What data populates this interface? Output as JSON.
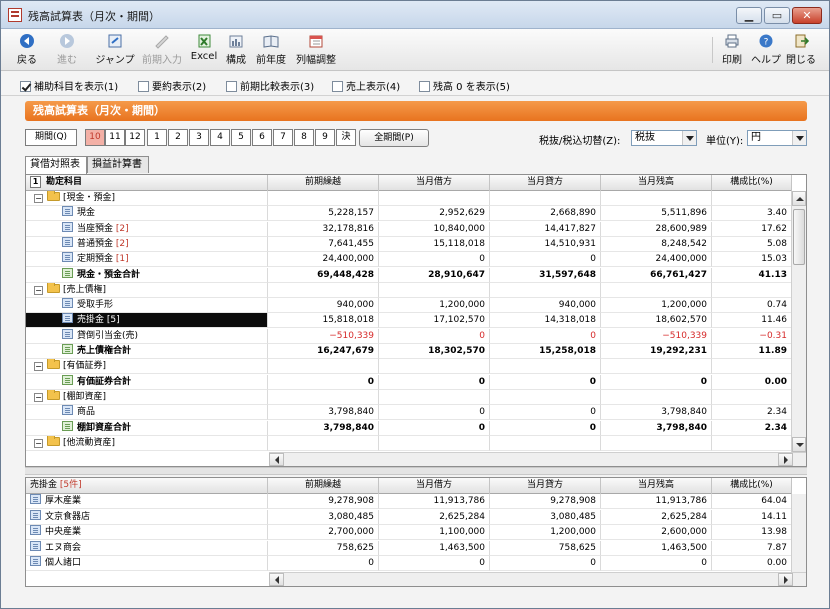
{
  "window": {
    "title": "残高試算表（月次・期間）",
    "controls": {
      "minimize": "▁",
      "maximize": "▭",
      "close": "✕"
    }
  },
  "toolbar": {
    "back": "戻る",
    "forward": "進む",
    "jump": "ジャンプ",
    "prev_input": "前期入力",
    "excel": "Excel",
    "composition": "構成",
    "prev_year": "前年度",
    "column_width": "列幅調整",
    "print": "印刷",
    "help": "ヘルプ",
    "close": "閉じる"
  },
  "options": [
    {
      "label": "補助科目を表示(1)",
      "checked": true
    },
    {
      "label": "要約表示(2)",
      "checked": false
    },
    {
      "label": "前期比較表示(3)",
      "checked": false
    },
    {
      "label": "売上表示(4)",
      "checked": false
    },
    {
      "label": "残高 0 を表示(5)",
      "checked": false
    }
  ],
  "report_title": "残高試算表（月次・期間）",
  "period": {
    "label": "期間(Q)",
    "months": [
      "10",
      "11",
      "12",
      "1",
      "2",
      "3",
      "4",
      "5",
      "6",
      "7",
      "8",
      "9",
      "決"
    ],
    "active_month": "10",
    "all_period": "全期間(P)"
  },
  "tax": {
    "label": "税抜/税込切替(Z):",
    "value": "税抜"
  },
  "unit": {
    "label": "単位(Y):",
    "value": "円"
  },
  "tabs": [
    "貸借対照表",
    "損益計算書"
  ],
  "main_table": {
    "columns": [
      "勘定科目",
      "前期繰越",
      "当月借方",
      "当月貸方",
      "当月残高",
      "構成比(%)"
    ],
    "header_number": "1",
    "rows": [
      {
        "type": "group",
        "name": "[現金・預金]"
      },
      {
        "type": "item",
        "name": "現金",
        "sub": "",
        "values": [
          "5,228,157",
          "2,952,629",
          "2,668,890",
          "5,511,896",
          "3.40"
        ]
      },
      {
        "type": "item",
        "name": "当座預金",
        "sub": "[2]",
        "values": [
          "32,178,816",
          "10,840,000",
          "14,417,827",
          "28,600,989",
          "17.62"
        ]
      },
      {
        "type": "item",
        "name": "普通預金",
        "sub": "[2]",
        "values": [
          "7,641,455",
          "15,118,018",
          "14,510,931",
          "8,248,542",
          "5.08"
        ]
      },
      {
        "type": "item",
        "name": "定期預金",
        "sub": "[1]",
        "values": [
          "24,400,000",
          "0",
          "0",
          "24,400,000",
          "15.03"
        ]
      },
      {
        "type": "sum",
        "name": "現金・預金合計",
        "sub": "",
        "values": [
          "69,448,428",
          "28,910,647",
          "31,597,648",
          "66,761,427",
          "41.13"
        ]
      },
      {
        "type": "group",
        "name": "[売上債権]"
      },
      {
        "type": "item",
        "name": "受取手形",
        "sub": "",
        "values": [
          "940,000",
          "1,200,000",
          "940,000",
          "1,200,000",
          "0.74"
        ]
      },
      {
        "type": "item",
        "name": "売掛金",
        "sub": "[5]",
        "selected": true,
        "values": [
          "15,818,018",
          "17,102,570",
          "14,318,018",
          "18,602,570",
          "11.46"
        ]
      },
      {
        "type": "item",
        "name": "貸倒引当金(売)",
        "sub": "",
        "negative": true,
        "values": [
          "−510,339",
          "0",
          "0",
          "−510,339",
          "−0.31"
        ]
      },
      {
        "type": "sum",
        "name": "売上債権合計",
        "sub": "",
        "values": [
          "16,247,679",
          "18,302,570",
          "15,258,018",
          "19,292,231",
          "11.89"
        ]
      },
      {
        "type": "group",
        "name": "[有価証券]"
      },
      {
        "type": "sum",
        "name": "有価証券合計",
        "sub": "",
        "values": [
          "0",
          "0",
          "0",
          "0",
          "0.00"
        ]
      },
      {
        "type": "group",
        "name": "[棚卸資産]"
      },
      {
        "type": "item",
        "name": "商品",
        "sub": "",
        "values": [
          "3,798,840",
          "0",
          "0",
          "3,798,840",
          "2.34"
        ]
      },
      {
        "type": "sum",
        "name": "棚卸資産合計",
        "sub": "",
        "values": [
          "3,798,840",
          "0",
          "0",
          "3,798,840",
          "2.34"
        ]
      },
      {
        "type": "group",
        "name": "[他流動資産]"
      }
    ]
  },
  "sub_table": {
    "title": "売掛金",
    "count": "[5件]",
    "columns": [
      "前期繰越",
      "当月借方",
      "当月貸方",
      "当月残高",
      "構成比(%)"
    ],
    "rows": [
      {
        "name": "厚木産業",
        "values": [
          "9,278,908",
          "11,913,786",
          "9,278,908",
          "11,913,786",
          "64.04"
        ]
      },
      {
        "name": "文京食器店",
        "values": [
          "3,080,485",
          "2,625,284",
          "3,080,485",
          "2,625,284",
          "14.11"
        ]
      },
      {
        "name": "中央産業",
        "values": [
          "2,700,000",
          "1,100,000",
          "1,200,000",
          "2,600,000",
          "13.98"
        ]
      },
      {
        "name": "エヌ商会",
        "values": [
          "758,625",
          "1,463,500",
          "758,625",
          "1,463,500",
          "7.87"
        ]
      },
      {
        "name": "個人諸口",
        "values": [
          "0",
          "0",
          "0",
          "0",
          "0.00"
        ]
      }
    ]
  }
}
